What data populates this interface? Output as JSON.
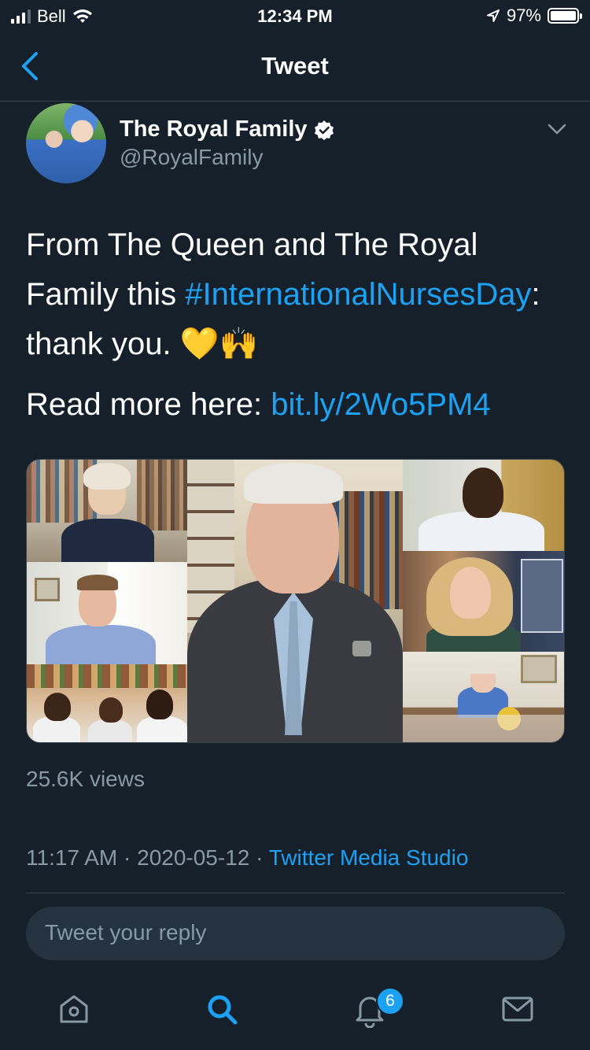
{
  "status_bar": {
    "carrier": "Bell",
    "time": "12:34 PM",
    "battery": "97%"
  },
  "nav": {
    "title": "Tweet"
  },
  "author": {
    "name": "The Royal Family",
    "handle": "@RoyalFamily"
  },
  "tweet": {
    "line1_part1": "From The Queen and The Royal Family this ",
    "hashtag": "#InternationalNursesDay",
    "line1_part2": ": thank you. 💛🙌",
    "line2_prefix": "Read more here: ",
    "link": "bit.ly/2Wo5PM4"
  },
  "media": {
    "views": "25.6K views"
  },
  "meta": {
    "time": "11:17 AM",
    "separator": "·",
    "date": "2020-05-12",
    "source": "Twitter Media Studio"
  },
  "reply": {
    "placeholder": "Tweet your reply"
  },
  "tab_bar": {
    "notifications_badge": "6"
  },
  "colors": {
    "background": "#15202b",
    "accent": "#1da1f2",
    "secondary_text": "#8899a6",
    "border": "#38444d"
  }
}
